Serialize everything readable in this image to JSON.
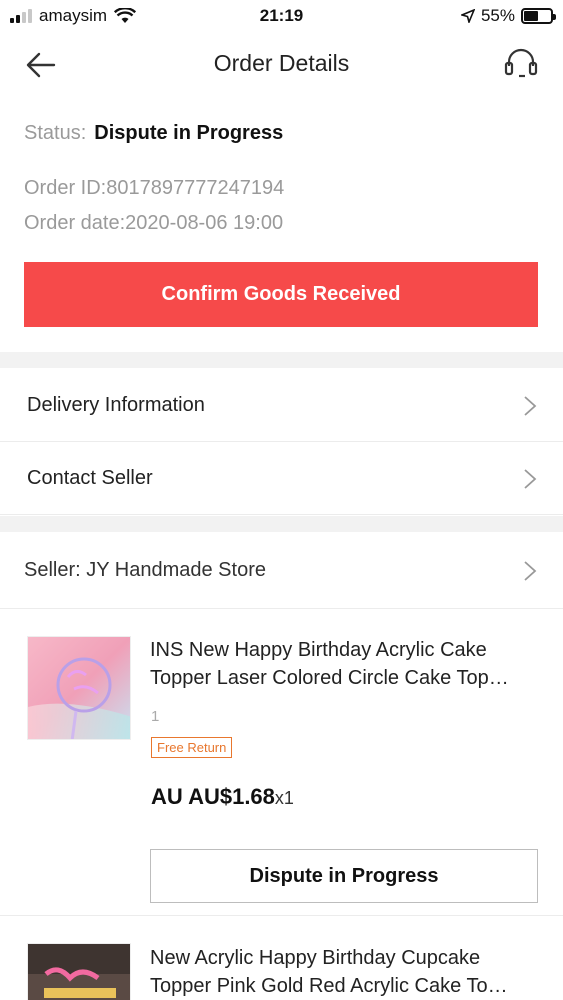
{
  "status_bar": {
    "carrier": "amaysim",
    "time": "21:19",
    "battery": "55%",
    "battery_level": 0.55,
    "signal_bars": 2
  },
  "nav": {
    "title": "Order Details",
    "back_icon": "arrow-left-icon",
    "support_icon": "headset-icon"
  },
  "order": {
    "status_label": "Status:",
    "status_value": "Dispute in Progress",
    "order_id": "Order ID:8017897777247194",
    "order_date": "Order date:2020-08-06 19:00",
    "confirm_label": "Confirm Goods Received"
  },
  "links": {
    "delivery": "Delivery Information",
    "contact": "Contact Seller"
  },
  "seller": {
    "label": "Seller: JY Handmade Store"
  },
  "products": [
    {
      "title": "INS New Happy Birthday Acrylic Cake Topper Laser Colored Circle Cake Top…",
      "sku": "1",
      "badge": "Free Return",
      "price_prefix": "AU AU$1.68",
      "quantity": "x1",
      "action": "Dispute in Progress"
    },
    {
      "title": "New Acrylic Happy Birthday Cupcake Topper Pink Gold Red Acrylic Cake To…"
    }
  ],
  "colors": {
    "accent": "#f64a4a",
    "badge": "#e8772e"
  }
}
